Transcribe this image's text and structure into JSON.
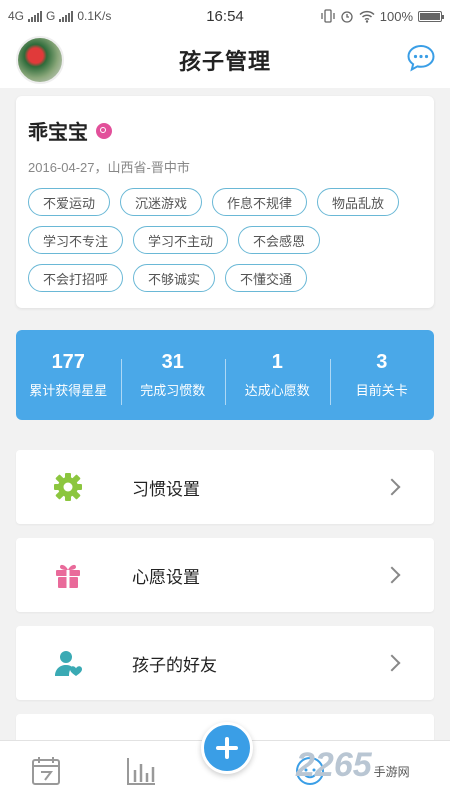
{
  "status_bar": {
    "network_1": "4G",
    "network_2": "G",
    "speed": "0.1K/s",
    "time": "16:54",
    "battery": "100%"
  },
  "header": {
    "title": "孩子管理",
    "avatar_icon": "child-avatar-photo",
    "message_icon": "chat-bubble-icon"
  },
  "profile": {
    "name": "乖宝宝",
    "gender_icon": "female-icon",
    "info": "2016-04-27，山西省-晋中市",
    "tags": [
      "不爱运动",
      "沉迷游戏",
      "作息不规律",
      "物品乱放",
      "学习不专注",
      "学习不主动",
      "不会感恩",
      "不会打招呼",
      "不够诚实",
      "不懂交通"
    ]
  },
  "stats": [
    {
      "value": "177",
      "label": "累计获得星星"
    },
    {
      "value": "31",
      "label": "完成习惯数"
    },
    {
      "value": "1",
      "label": "达成心愿数"
    },
    {
      "value": "3",
      "label": "目前关卡"
    }
  ],
  "menu": [
    {
      "label": "习惯设置",
      "icon": "gear-icon"
    },
    {
      "label": "心愿设置",
      "icon": "gift-icon"
    },
    {
      "label": "孩子的好友",
      "icon": "friend-icon"
    }
  ],
  "tabbar": {
    "tabs": [
      "calendar-icon",
      "chart-icon",
      "plus-icon",
      "child-icon"
    ]
  },
  "watermark": {
    "text": "2265",
    "suffix": "手游网"
  },
  "colors": {
    "accent": "#4aa8e8",
    "tag_border": "#6ab8d6",
    "gear": "#8cc63f",
    "gift": "#e96a9a",
    "friend": "#3aaab4"
  }
}
